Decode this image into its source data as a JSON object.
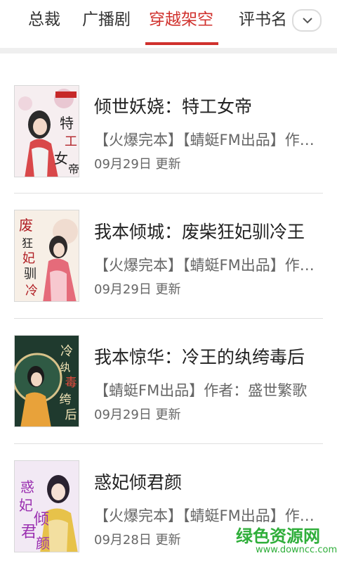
{
  "tabs": [
    {
      "label": "总裁"
    },
    {
      "label": "广播剧"
    },
    {
      "label": "穿越架空"
    },
    {
      "label": "评书名"
    }
  ],
  "active_tab": "穿越架空",
  "expand_icon": "chevron-down-icon",
  "books": [
    {
      "title": "倾世妖娆：特工女帝",
      "desc": "【火爆完本】【蜻蜓FM出品】作者：",
      "date": "09月29日 更新",
      "cover_text": "特工女帝"
    },
    {
      "title": "我本倾城：废柴狂妃驯冷王",
      "desc": "【火爆完本】【蜻蜓FM出品】作者：",
      "date": "09月29日 更新",
      "cover_text": "废柴狂妃驯冷王"
    },
    {
      "title": "我本惊华：冷王的纨绔毒后",
      "desc": "【蜻蜓FM出品】作者：盛世繁歌 ",
      "date": "09月29日 更新",
      "cover_text": "冷王的纨绔毒后"
    },
    {
      "title": "惑妃倾君颜",
      "desc": "【火爆完本】【蜻蜓FM出品】作者：",
      "date": "09月28日 更新",
      "cover_text": "惑妃倾君颜"
    }
  ],
  "watermark": {
    "name": "绿色资源网",
    "url": "www.downcc.com"
  },
  "colors": {
    "accent": "#d0312d",
    "watermark": "#2fae3a"
  }
}
